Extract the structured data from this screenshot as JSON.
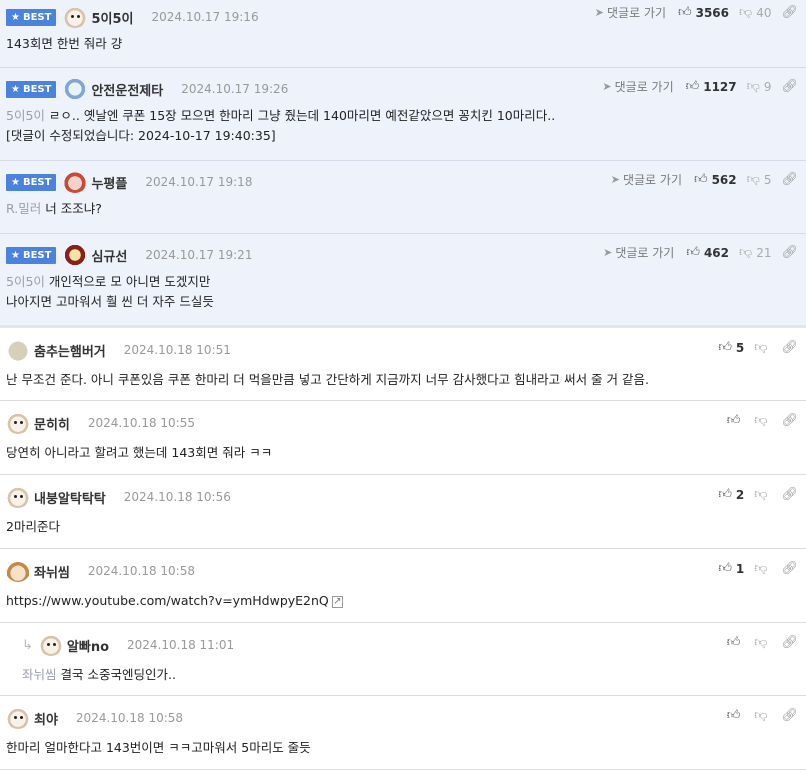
{
  "best_label": "BEST",
  "goto_label": "댓글로 가기",
  "best_comments": [
    {
      "nick": "5이5이",
      "date": "2024.10.17 19:16",
      "likes": "3566",
      "dislikes": "40",
      "ref": "",
      "lines": [
        "143회면 한번 줘라 걍"
      ]
    },
    {
      "nick": "안전운전제타",
      "date": "2024.10.17 19:26",
      "likes": "1127",
      "dislikes": "9",
      "ref": "5이5이",
      "lines": [
        "ㄹㅇ.. 옛날엔 쿠폰 15장 모으면 한마리 그냥 줬는데 140마리면 예전같았으면 꽁치킨 10마리다..",
        "[댓글이 수정되었습니다: 2024-10-17 19:40:35]"
      ]
    },
    {
      "nick": "누평플",
      "date": "2024.10.17 19:18",
      "likes": "562",
      "dislikes": "5",
      "ref": "R.밀러",
      "lines": [
        "너 조조냐?"
      ]
    },
    {
      "nick": "심규선",
      "date": "2024.10.17 19:21",
      "likes": "462",
      "dislikes": "21",
      "ref": "5이5이",
      "lines": [
        "개인적으로 모 아니면 도겠지만",
        "나아지면 고마워서 훨 씬 더 자주 드실듯"
      ]
    }
  ],
  "comments": [
    {
      "nick": "춤추는햄버거",
      "date": "2024.10.18 10:51",
      "likes": "5",
      "ref": "",
      "text": "난 무조건 준다. 아니 쿠폰있음 쿠폰 한마리 더 먹을만큼 넣고 간단하게 지금까지 너무 감사했다고 힘내라고 써서 줄 거 같음."
    },
    {
      "nick": "문히히",
      "date": "2024.10.18 10:55",
      "likes": "",
      "ref": "",
      "text": "당연히 아니라고 할려고 했는데 143회면 줘라 ㅋㅋ"
    },
    {
      "nick": "내붕알탁탁탁",
      "date": "2024.10.18 10:56",
      "likes": "2",
      "ref": "",
      "text": "2마리준다"
    },
    {
      "nick": "좌뉘씸",
      "date": "2024.10.18 10:58",
      "likes": "1",
      "ref": "",
      "text": "https://www.youtube.com/watch?v=ymHdwpyE2nQ"
    },
    {
      "nick": "알빠no",
      "date": "2024.10.18 11:01",
      "likes": "",
      "ref": "좌뉘씸",
      "text": "결국 소중국엔딩인가.."
    },
    {
      "nick": "최야",
      "date": "2024.10.18 10:58",
      "likes": "",
      "ref": "",
      "text": "한마리 얼마한다고 143번이면 ㅋㅋ고마워서 5마리도 줄듯"
    }
  ]
}
